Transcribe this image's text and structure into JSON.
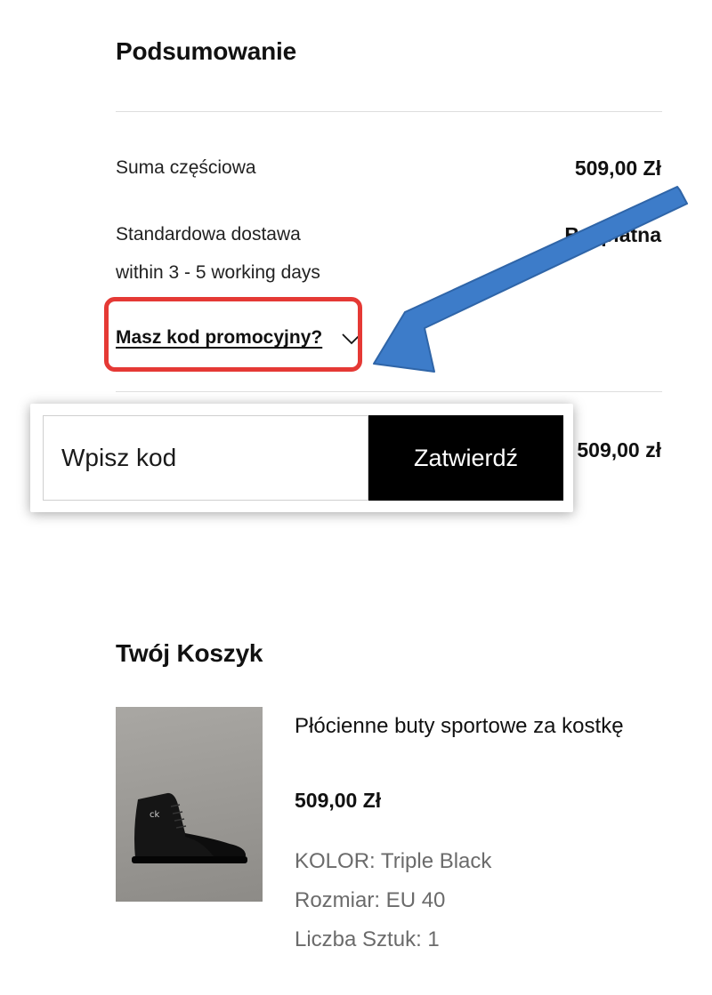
{
  "summary": {
    "title": "Podsumowanie",
    "subtotal_label": "Suma częściowa",
    "subtotal_value": "509,00 Zł",
    "shipping_label": "Standardowa dostawa",
    "shipping_value": "Bezpłatna",
    "shipping_note": "within 3 - 5 working days",
    "promo_link": "Masz kod promocyjny?",
    "total_value": "509,00 zł"
  },
  "promo_popup": {
    "input_placeholder": "Wpisz kod",
    "submit_label": "Zatwierdź"
  },
  "cart": {
    "title": "Twój Koszyk",
    "item": {
      "name": "Płócienne buty sportowe za kostkę",
      "price": "509,00 Zł",
      "color": "KOLOR: Triple Black",
      "size": "Rozmiar: EU 40",
      "quantity": "Liczba Sztuk: 1"
    }
  },
  "colors": {
    "highlight": "#e53935",
    "arrow": "#3d7cc9",
    "button": "#000000"
  },
  "icons": {
    "chevron": "chevron-down-icon",
    "arrow": "arrow-annotation-icon"
  }
}
